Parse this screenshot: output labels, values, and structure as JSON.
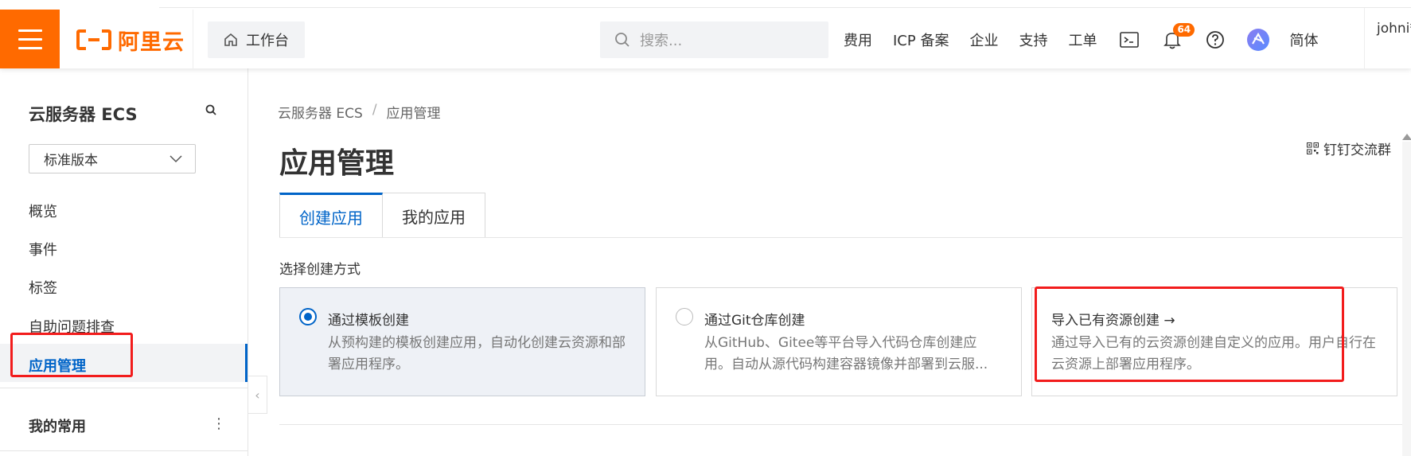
{
  "topbar": {
    "logo_text": "阿里云",
    "workbench_label": "工作台",
    "search_placeholder": "搜索...",
    "links": [
      "费用",
      "ICP 备案",
      "企业",
      "支持",
      "工单"
    ],
    "notification_count": "64",
    "language": "简体",
    "user_name": "johni*",
    "brand_color": "#ff6a00"
  },
  "sidebar": {
    "title": "云服务器 ECS",
    "version_select": "标准版本",
    "items": [
      "概览",
      "事件",
      "标签",
      "自助问题排查",
      "应用管理"
    ],
    "active_item": "应用管理",
    "favorites_label": "我的常用",
    "accent_color": "#0064c8"
  },
  "main": {
    "breadcrumb": [
      "云服务器 ECS",
      "应用管理"
    ],
    "page_title": "应用管理",
    "dingtalk_label": "钉钉交流群",
    "tabs": [
      "创建应用",
      "我的应用"
    ],
    "active_tab": "创建应用",
    "section_label": "选择创建方式",
    "cards": [
      {
        "title": "通过模板创建",
        "desc": "从预构建的模板创建应用，自动化创建云资源和部署应用程序。",
        "selected": true
      },
      {
        "title": "通过Git仓库创建",
        "desc": "从GitHub、Gitee等平台导入代码仓库创建应用。自动从源代码构建容器镜像并部署到云服...",
        "selected": false
      },
      {
        "title": "导入已有资源创建 →",
        "desc": "通过导入已有的云资源创建自定义的应用。用户自行在云资源上部署应用程序。",
        "selected": false
      }
    ]
  }
}
